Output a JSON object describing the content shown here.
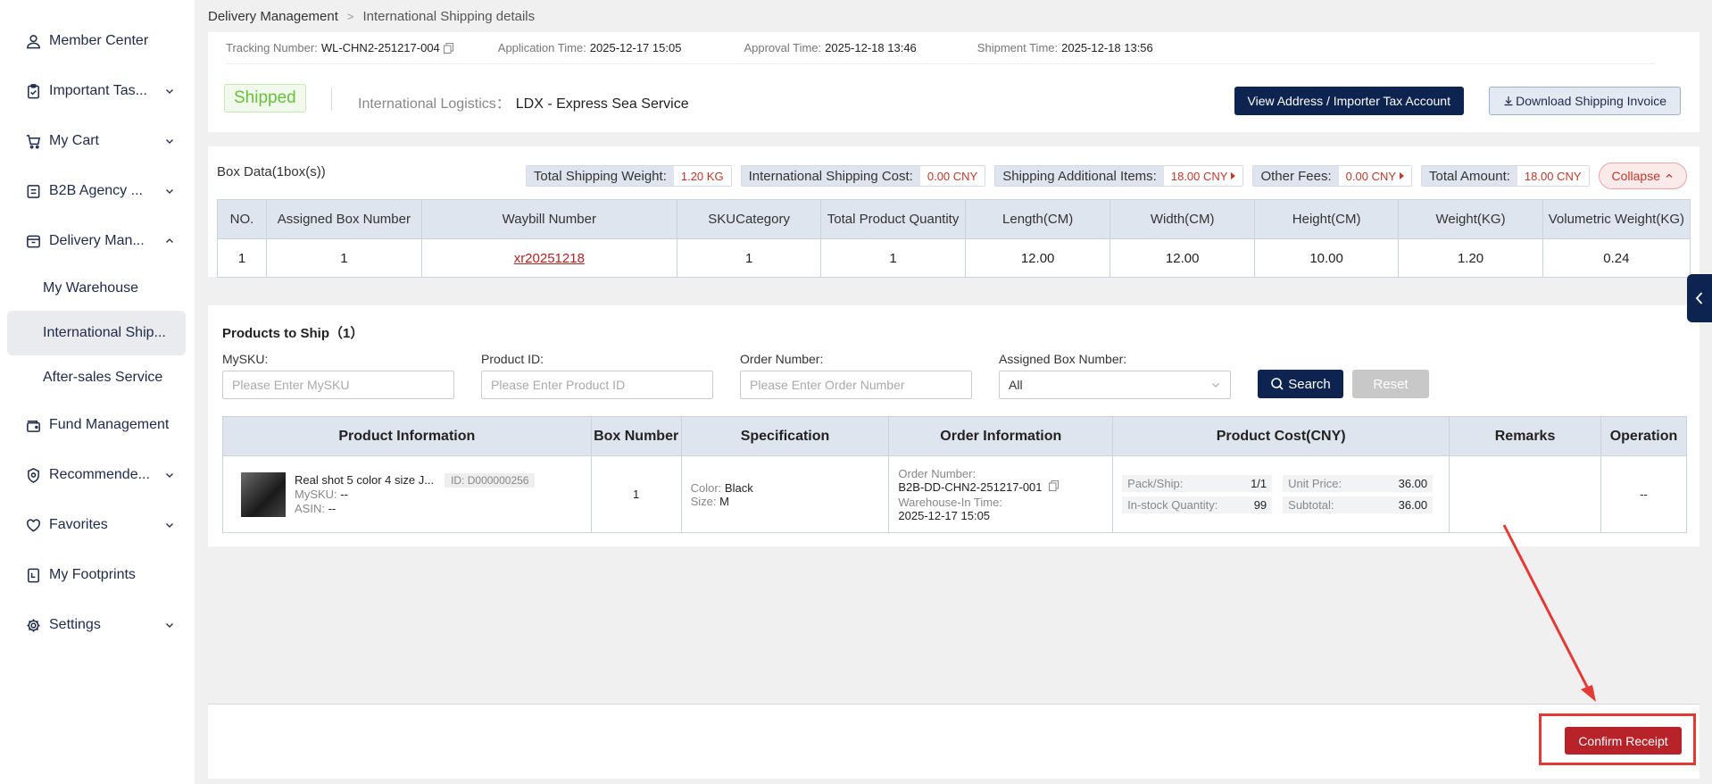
{
  "sidebar": {
    "items": [
      {
        "label": "Member Center",
        "icon": "user-icon"
      },
      {
        "label": "Important Tas...",
        "icon": "clipboard-icon"
      },
      {
        "label": "My Cart",
        "icon": "cart-icon"
      },
      {
        "label": "B2B Agency ...",
        "icon": "document-icon"
      },
      {
        "label": "Delivery Man...",
        "icon": "box-icon"
      }
    ],
    "sub_items": [
      {
        "label": "My Warehouse"
      },
      {
        "label": "International Ship..."
      },
      {
        "label": "After-sales Service"
      }
    ],
    "items_after": [
      {
        "label": "Fund Management",
        "icon": "wallet-icon"
      },
      {
        "label": "Recommende...",
        "icon": "badge-icon"
      },
      {
        "label": "Favorites",
        "icon": "heart-icon"
      },
      {
        "label": "My Footprints",
        "icon": "footprint-icon"
      },
      {
        "label": "Settings",
        "icon": "gear-icon"
      }
    ]
  },
  "breadcrumb": {
    "root": "Delivery Management",
    "sep": ">",
    "current": "International Shipping details"
  },
  "meta": {
    "tracking_label": "Tracking Number:",
    "tracking_value": "WL-CHN2-251217-004",
    "application_label": "Application Time:",
    "application_value": "2025-12-17 15:05",
    "approval_label": "Approval Time:",
    "approval_value": "2025-12-18 13:46",
    "shipment_label": "Shipment Time:",
    "shipment_value": "2025-12-18 13:56"
  },
  "status": {
    "badge": "Shipped",
    "logistics_label": "International Logistics：",
    "logistics_value": "LDX - Express Sea Service",
    "view_address_button": "View Address / Importer Tax Account",
    "download_invoice_button": "Download Shipping Invoice"
  },
  "box_data": {
    "title": "Box Data(1box(s))",
    "fees": [
      {
        "label": "Total Shipping Weight:",
        "value": "1.20 KG",
        "arrow": false
      },
      {
        "label": "International Shipping Cost:",
        "value": "0.00 CNY",
        "arrow": false
      },
      {
        "label": "Shipping Additional Items:",
        "value": "18.00 CNY",
        "arrow": true
      },
      {
        "label": "Other Fees:",
        "value": "0.00 CNY",
        "arrow": true
      },
      {
        "label": "Total Amount:",
        "value": "18.00 CNY",
        "arrow": false
      }
    ],
    "collapse_label": "Collapse",
    "columns": [
      "NO.",
      "Assigned Box Number",
      "Waybill Number",
      "SKUCategory",
      "Total Product Quantity",
      "Length(CM)",
      "Width(CM)",
      "Height(CM)",
      "Weight(KG)",
      "Volumetric Weight(KG)"
    ],
    "row": {
      "no": "1",
      "box": "1",
      "waybill": "xr20251218",
      "sku": "1",
      "qty": "1",
      "length": "12.00",
      "width": "12.00",
      "height": "10.00",
      "weight": "1.20",
      "volumetric": "0.24"
    }
  },
  "products": {
    "title": "Products to Ship（1）",
    "filters": {
      "mysku_label": "MySKU:",
      "mysku_placeholder": "Please Enter MySKU",
      "product_id_label": "Product ID:",
      "product_id_placeholder": "Please Enter Product ID",
      "order_number_label": "Order Number:",
      "order_number_placeholder": "Please Enter Order Number",
      "box_number_label": "Assigned Box Number:",
      "box_number_value": "All"
    },
    "search_button": "Search",
    "reset_button": "Reset",
    "columns": {
      "info": "Product Information",
      "box": "Box Number",
      "spec": "Specification",
      "order": "Order Information",
      "cost": "Product Cost(CNY)",
      "remarks": "Remarks",
      "operation": "Operation"
    },
    "row": {
      "name": "Real shot 5 color 4 size J...",
      "id_chip": "ID: D000000256",
      "mysku_label": "MySKU:",
      "mysku_value": "--",
      "asin_label": "ASIN:",
      "asin_value": "--",
      "box_number": "1",
      "color_label": "Color:",
      "color_value": "Black",
      "size_label": "Size:",
      "size_value": "M",
      "order_number_label": "Order Number:",
      "order_number_value": "B2B-DD-CHN2-251217-001",
      "warehouse_in_label": "Warehouse-In Time:",
      "warehouse_in_value": "2025-12-17 15:05",
      "pack_label": "Pack/Ship:",
      "pack_value": "1/1",
      "unit_price_label": "Unit Price:",
      "unit_price_value": "36.00",
      "instock_label": "In-stock Quantity:",
      "instock_value": "99",
      "subtotal_label": "Subtotal:",
      "subtotal_value": "36.00",
      "remarks": "",
      "operation": "--"
    }
  },
  "footer": {
    "confirm_button": "Confirm Receipt"
  },
  "colors": {
    "navy": "#0d2450",
    "accent_red": "#b8232a",
    "annotation_red": "#e53935",
    "shipped_green": "#67c23a"
  }
}
